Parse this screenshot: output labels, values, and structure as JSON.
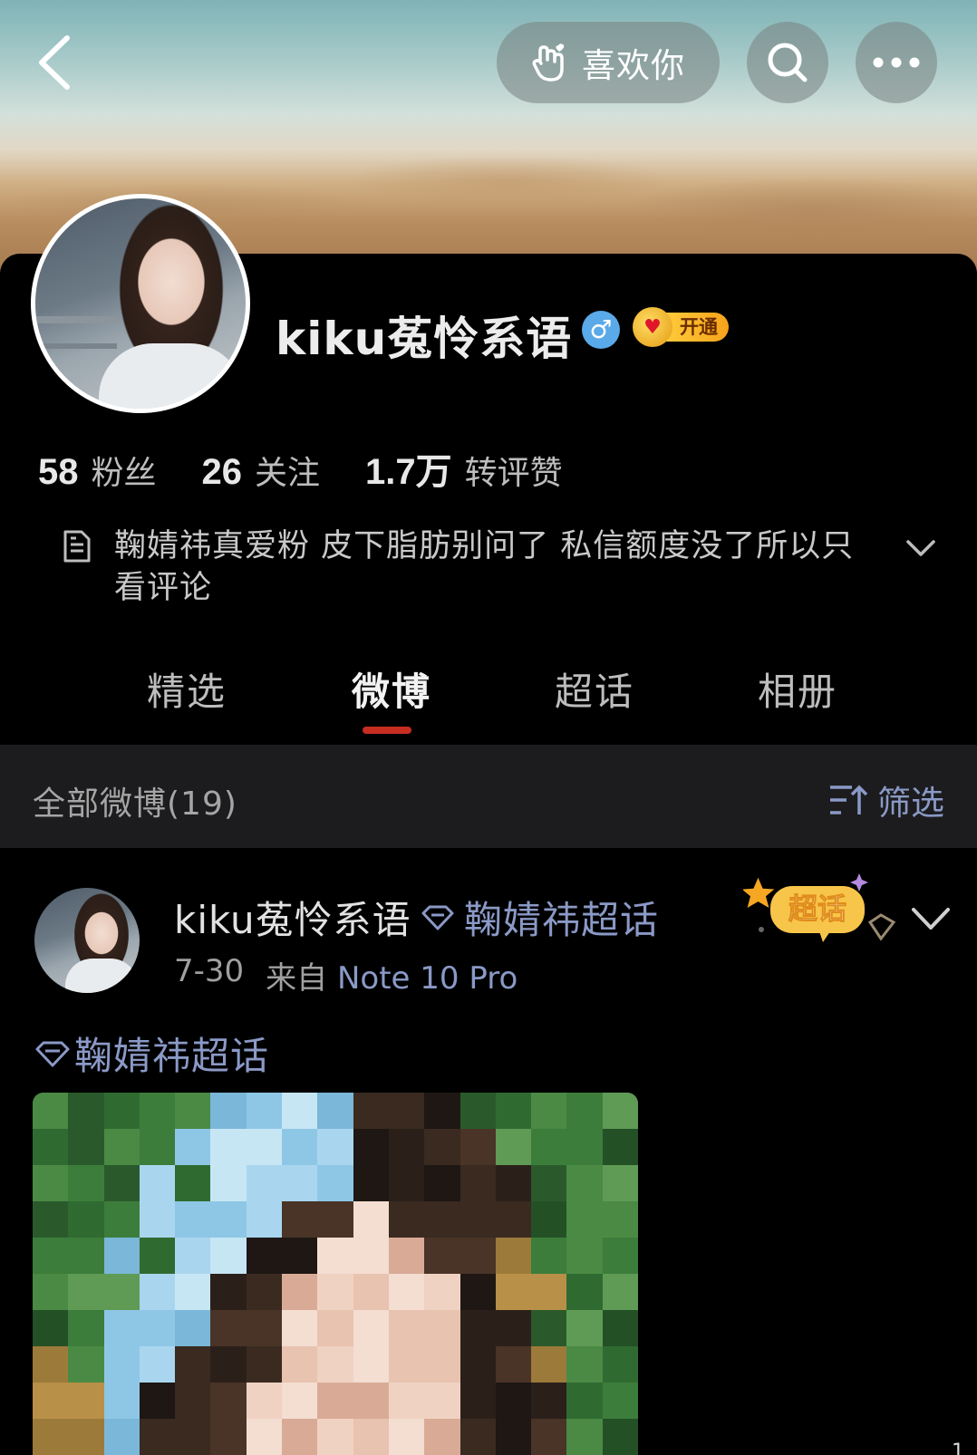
{
  "header": {
    "like_label": "喜欢你"
  },
  "profile": {
    "name": "kiku菟怜系语",
    "gender_symbol": "♂",
    "vip_label": "开通",
    "stats": [
      {
        "num": "58",
        "label": "粉丝"
      },
      {
        "num": "26",
        "label": "关注"
      },
      {
        "num": "1.7万",
        "label": "转评赞"
      }
    ],
    "bio": "鞠婧祎真爱粉 皮下脂肪别问了 私信额度没了所以只看评论"
  },
  "tabs": [
    {
      "label": "精选",
      "active": false
    },
    {
      "label": "微博",
      "active": true
    },
    {
      "label": "超话",
      "active": false
    },
    {
      "label": "相册",
      "active": false
    }
  ],
  "filter": {
    "count_label": "全部微博(19)",
    "filter_label": "筛选"
  },
  "post": {
    "author": "kiku菟怜系语",
    "topic": "鞠婧祎超话",
    "date": "7-30",
    "from_label": "来自",
    "source": "Note 10 Pro",
    "badge_label": "超话",
    "tag": "鞠婧祎超话"
  },
  "colors": {
    "accent_link": "#8a99c6",
    "tab_indicator": "#c62d21",
    "background": "#000000",
    "filter_bar": "#1c1c1e"
  },
  "icons": [
    "back-arrow-icon",
    "hand-heart-icon",
    "search-icon",
    "more-dots-icon",
    "document-icon",
    "chevron-down-icon",
    "filter-icon",
    "diamond-icon"
  ],
  "footer": {
    "page_indicator": "1"
  }
}
